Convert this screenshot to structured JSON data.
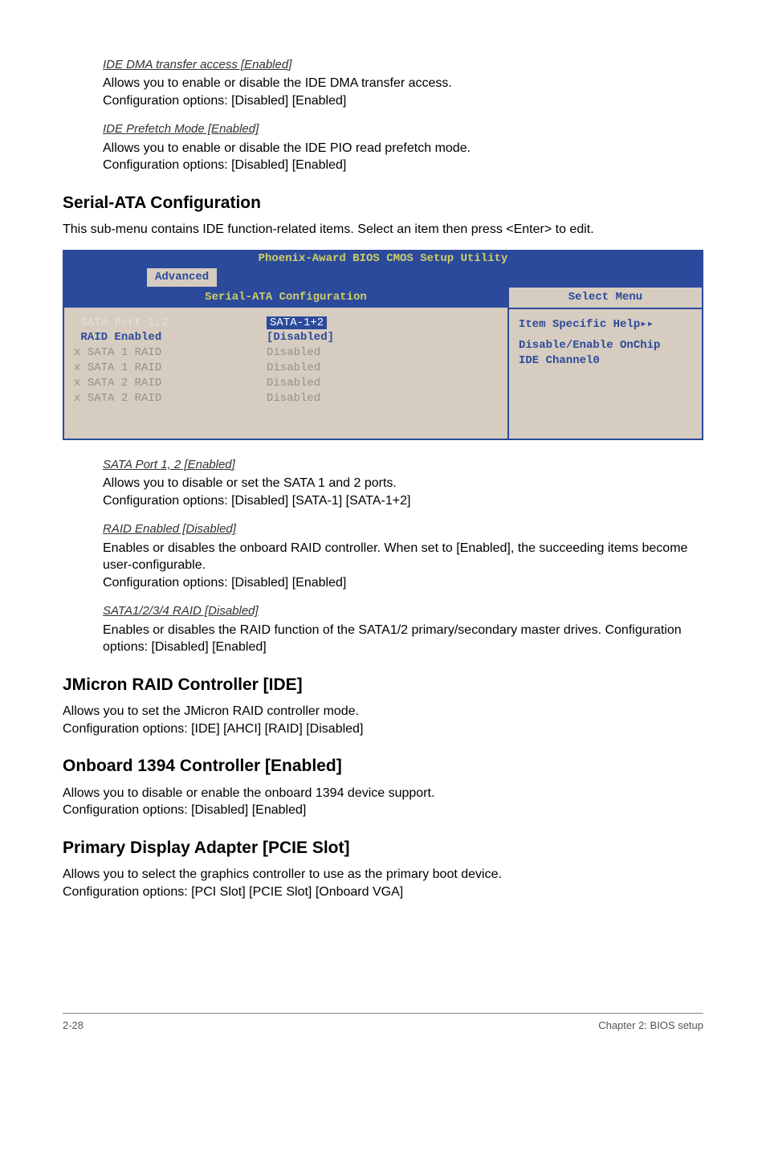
{
  "top": {
    "ide_dma_title": "IDE DMA transfer access [Enabled]",
    "ide_dma_l1": "Allows you to enable or disable the IDE DMA transfer access.",
    "ide_dma_l2": "Configuration options: [Disabled] [Enabled]",
    "ide_prefetch_title": "IDE Prefetch Mode [Enabled]",
    "ide_prefetch_l1": "Allows you to enable or disable the IDE PIO read prefetch mode.",
    "ide_prefetch_l2": "Configuration options: [Disabled] [Enabled]"
  },
  "serial_ata": {
    "heading": "Serial-ATA Configuration",
    "lead": "This sub-menu contains IDE function-related items. Select an item then press <Enter> to edit."
  },
  "bios": {
    "title": "Phoenix-Award BIOS CMOS Setup Utility",
    "tab": "Advanced",
    "subhead": "Serial-ATA Configuration",
    "select_menu": "Select Menu",
    "rows": [
      {
        "prefix": " ",
        "label": "SATA Port 1,2",
        "value": "SATA-1+2",
        "top": true,
        "selected": true
      },
      {
        "prefix": " ",
        "label": "RAID Enabled",
        "value": "[Disabled]",
        "enabled": true
      },
      {
        "prefix": "x",
        "label": "SATA 1 RAID",
        "value": "Disabled"
      },
      {
        "prefix": "x",
        "label": "SATA 1 RAID",
        "value": "Disabled"
      },
      {
        "prefix": "x",
        "label": "SATA 2 RAID",
        "value": "Disabled"
      },
      {
        "prefix": "x",
        "label": "SATA 2 RAID",
        "value": "Disabled"
      }
    ],
    "help1": "Item Specific Help",
    "help2": "Disable/Enable OnChip",
    "help3": "IDE Channel0"
  },
  "after_bios": {
    "sata_port_title": "SATA Port 1, 2 [Enabled]",
    "sata_port_l1": "Allows you to disable or set the SATA 1 and 2 ports.",
    "sata_port_l2": "Configuration options: [Disabled] [SATA-1] [SATA-1+2]",
    "raid_en_title": "RAID Enabled [Disabled]",
    "raid_en_l1": "Enables or disables the onboard RAID controller. When set to [Enabled], the succeeding items become user-configurable.",
    "raid_en_l2": "Configuration options: [Disabled] [Enabled]",
    "sata_raid_title": "SATA1/2/3/4 RAID [Disabled]",
    "sata_raid_l1": "Enables or disables the RAID function of the SATA1/2 primary/secondary master drives. Configuration options: [Disabled] [Enabled]"
  },
  "jmicron": {
    "heading": "JMicron RAID Controller [IDE]",
    "l1": "Allows you to set the JMicron RAID controller mode.",
    "l2": "Configuration options: [IDE] [AHCI] [RAID] [Disabled]"
  },
  "onboard1394": {
    "heading": "Onboard 1394 Controller [Enabled]",
    "l1": "Allows you to disable or enable the onboard 1394 device support.",
    "l2": "Configuration options: [Disabled] [Enabled]"
  },
  "primary_display": {
    "heading": "Primary Display Adapter [PCIE Slot]",
    "l1": "Allows you to select the graphics controller to use as the primary boot device.",
    "l2": "Configuration options: [PCI Slot] [PCIE Slot] [Onboard VGA]"
  },
  "footer": {
    "left": "2-28",
    "right": "Chapter 2: BIOS setup"
  }
}
